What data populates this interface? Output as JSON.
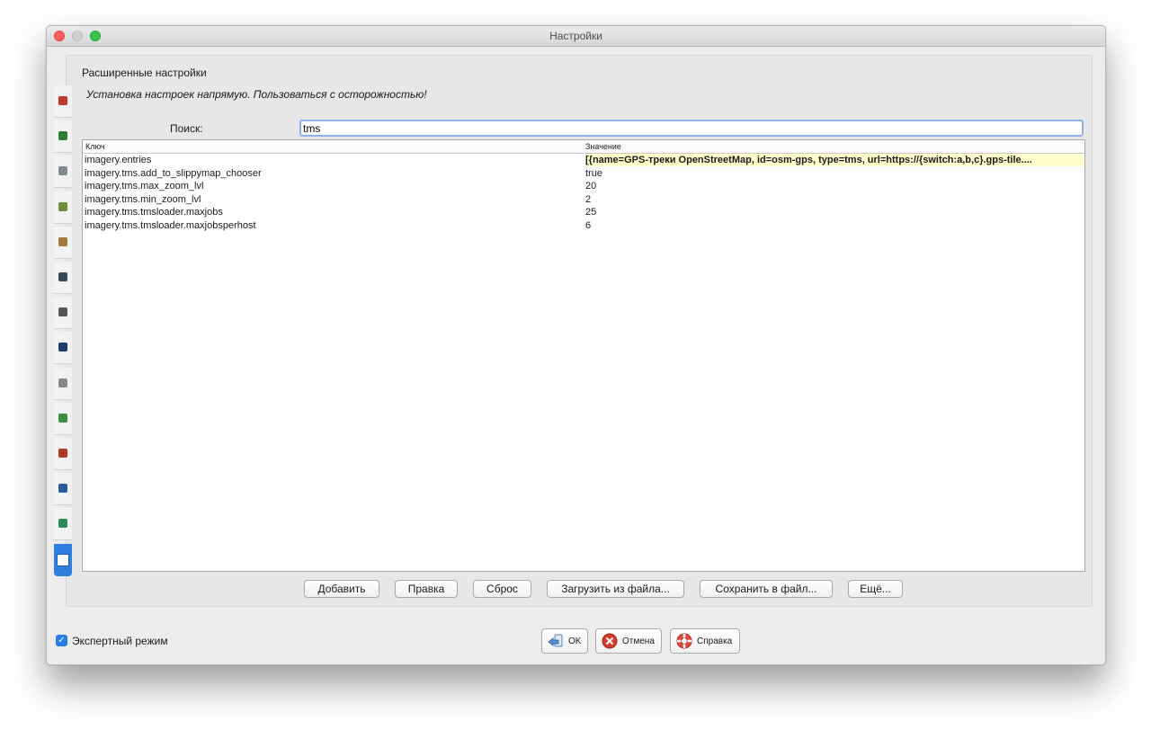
{
  "window": {
    "title": "Настройки"
  },
  "panel": {
    "section_title": "Расширенные настройки",
    "warning": "Установка настроек напрямую. Пользоваться с осторожностью!"
  },
  "search": {
    "label": "Поиск:",
    "value": "tms"
  },
  "table": {
    "columns": {
      "key": "Ключ",
      "value": "Значение"
    },
    "rows": [
      {
        "key": "imagery.entries",
        "value": "[{name=GPS-треки OpenStreetMap, id=osm-gps, type=tms, url=https://{switch:a,b,c}.gps-tile...."
      },
      {
        "key": "imagery.tms.add_to_slippymap_chooser",
        "value": "true"
      },
      {
        "key": "imagery.tms.max_zoom_lvl",
        "value": "20"
      },
      {
        "key": "imagery.tms.min_zoom_lvl",
        "value": "2"
      },
      {
        "key": "imagery.tms.tmsloader.maxjobs",
        "value": "25"
      },
      {
        "key": "imagery.tms.tmsloader.maxjobsperhost",
        "value": "6"
      }
    ]
  },
  "actions": {
    "add": "Добавить",
    "edit": "Правка",
    "reset": "Сброс",
    "load": "Загрузить из файла...",
    "save": "Сохранить в файл...",
    "more": "Ещё..."
  },
  "footer": {
    "expert_mode": "Экспертный режим",
    "expert_checked": true,
    "ok": "OK",
    "cancel": "Отмена",
    "help": "Справка"
  },
  "sidebar": {
    "tabs": [
      {
        "icon": "display-settings-icon",
        "color": "#c0392b"
      },
      {
        "icon": "connection-globe-icon",
        "color": "#2e7d32"
      },
      {
        "icon": "projection-icon",
        "color": "#7f8c8d"
      },
      {
        "icon": "map-paint-icon",
        "color": "#6d8f3a"
      },
      {
        "icon": "presets-icon",
        "color": "#a37a3b"
      },
      {
        "icon": "plugins-icon",
        "color": "#34495e"
      },
      {
        "icon": "shortcuts-icon",
        "color": "#555555"
      },
      {
        "icon": "validator-icon",
        "color": "#1f3b6e"
      },
      {
        "icon": "audio-icon",
        "color": "#888888"
      },
      {
        "icon": "remote-control-icon",
        "color": "#3e8e41"
      },
      {
        "icon": "tagging-icon",
        "color": "#b03a2e"
      },
      {
        "icon": "imagery-icon",
        "color": "#2a5d9f"
      },
      {
        "icon": "elevation-icon",
        "color": "#2e8b57"
      },
      {
        "icon": "advanced-preferences-icon",
        "color": "#2f7fe0",
        "active": true
      }
    ]
  }
}
